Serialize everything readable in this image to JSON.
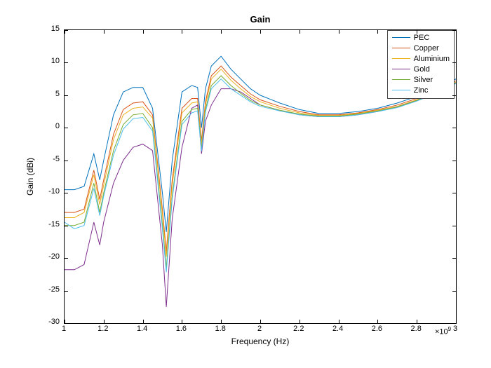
{
  "chart_data": {
    "type": "line",
    "title": "Gain",
    "xlabel": "Frequency (Hz)",
    "ylabel": "Gain (dBi)",
    "x_exponent": "×10^9",
    "xlim": [
      1.0,
      3.0
    ],
    "ylim": [
      -30,
      15
    ],
    "xticks": [
      1,
      1.2,
      1.4,
      1.6,
      1.8,
      2,
      2.2,
      2.4,
      2.6,
      2.8,
      3
    ],
    "yticks": [
      -30,
      -25,
      -20,
      -15,
      -10,
      -5,
      0,
      5,
      10,
      15
    ],
    "x": [
      1.0,
      1.05,
      1.1,
      1.15,
      1.18,
      1.2,
      1.25,
      1.3,
      1.35,
      1.4,
      1.45,
      1.5,
      1.52,
      1.55,
      1.6,
      1.65,
      1.68,
      1.7,
      1.72,
      1.75,
      1.8,
      1.85,
      1.9,
      1.95,
      2.0,
      2.1,
      2.2,
      2.3,
      2.4,
      2.5,
      2.6,
      2.7,
      2.8,
      2.9,
      3.0
    ],
    "series": [
      {
        "name": "PEC",
        "color": "#0072BD",
        "values": [
          -9.5,
          -9.5,
          -9.0,
          -4.0,
          -8.0,
          -5.0,
          2.0,
          5.5,
          6.2,
          6.2,
          3.0,
          -10.0,
          -16.0,
          -5.0,
          5.5,
          6.5,
          6.2,
          0.0,
          6.0,
          9.5,
          11.0,
          9.0,
          7.5,
          6.0,
          5.0,
          3.8,
          2.8,
          2.2,
          2.2,
          2.5,
          3.0,
          3.8,
          4.8,
          6.0,
          7.5
        ]
      },
      {
        "name": "Copper",
        "color": "#D95319",
        "values": [
          -13.0,
          -13.0,
          -12.5,
          -6.5,
          -11.0,
          -8.0,
          -1.0,
          2.8,
          3.8,
          4.0,
          2.0,
          -12.5,
          -19.0,
          -8.0,
          3.0,
          4.5,
          4.5,
          -2.0,
          4.0,
          8.0,
          9.5,
          7.8,
          6.5,
          5.2,
          4.3,
          3.3,
          2.5,
          2.0,
          2.0,
          2.3,
          2.8,
          3.5,
          4.5,
          5.7,
          7.2
        ]
      },
      {
        "name": "Aluminium",
        "color": "#EDB120",
        "values": [
          -13.8,
          -13.8,
          -13.0,
          -7.2,
          -11.8,
          -8.8,
          -1.8,
          2.0,
          3.0,
          3.2,
          1.5,
          -13.2,
          -19.8,
          -8.8,
          2.3,
          3.8,
          4.0,
          -2.5,
          3.5,
          7.5,
          9.0,
          7.3,
          6.0,
          4.8,
          4.0,
          3.0,
          2.3,
          1.9,
          1.9,
          2.2,
          2.7,
          3.3,
          4.3,
          5.5,
          7.0
        ]
      },
      {
        "name": "Gold",
        "color": "#7E2F8E",
        "values": [
          -21.8,
          -21.8,
          -21.0,
          -14.5,
          -18.0,
          -14.5,
          -8.5,
          -5.0,
          -3.0,
          -2.5,
          -3.5,
          -18.0,
          -27.5,
          -14.0,
          -3.0,
          3.0,
          3.5,
          -4.0,
          1.0,
          3.5,
          6.0,
          6.0,
          5.5,
          4.5,
          3.5,
          2.7,
          2.0,
          1.7,
          1.7,
          2.0,
          2.5,
          3.2,
          4.2,
          5.4,
          6.9
        ]
      },
      {
        "name": "Silver",
        "color": "#77AC30",
        "values": [
          -15.0,
          -15.0,
          -14.5,
          -8.5,
          -13.0,
          -10.0,
          -3.5,
          0.5,
          2.0,
          2.2,
          0.0,
          -14.8,
          -21.5,
          -10.5,
          1.0,
          2.8,
          3.0,
          -3.2,
          2.8,
          6.5,
          8.0,
          6.5,
          5.3,
          4.2,
          3.5,
          2.7,
          2.1,
          1.8,
          1.8,
          2.1,
          2.6,
          3.2,
          4.2,
          5.4,
          6.9
        ]
      },
      {
        "name": "Zinc",
        "color": "#4DBEEE",
        "values": [
          -14.5,
          -15.5,
          -15.0,
          -9.3,
          -13.5,
          -10.5,
          -4.2,
          -0.2,
          1.4,
          1.6,
          -0.5,
          -15.5,
          -22.2,
          -11.0,
          0.5,
          2.3,
          2.6,
          -3.6,
          2.4,
          6.0,
          7.5,
          6.0,
          5.0,
          4.0,
          3.3,
          2.6,
          2.0,
          1.7,
          1.7,
          2.0,
          2.5,
          3.1,
          4.1,
          5.3,
          6.8
        ]
      }
    ],
    "legend_position": "upper-right"
  }
}
